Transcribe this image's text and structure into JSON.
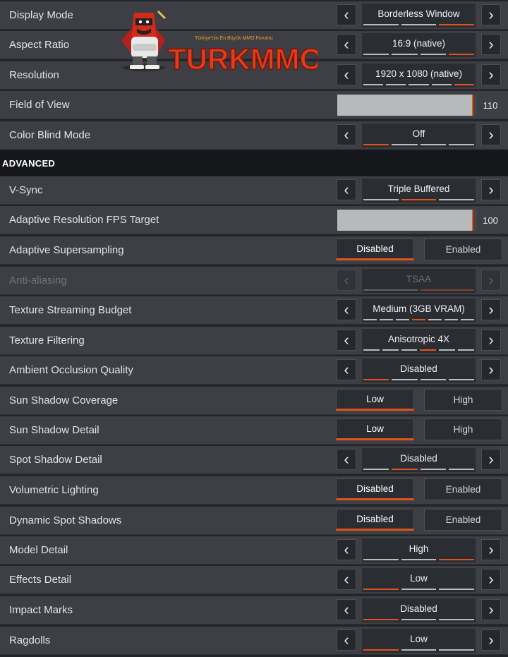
{
  "rows": [
    {
      "label": "Display Mode",
      "type": "selector",
      "value": "Borderless Window",
      "segments": 3,
      "active": 2
    },
    {
      "label": "Aspect Ratio",
      "type": "selector",
      "value": "16:9 (native)",
      "segments": 4,
      "active": 3
    },
    {
      "label": "Resolution",
      "type": "selector",
      "value": "1920 x 1080 (native)",
      "segments": 5,
      "active": 4
    },
    {
      "label": "Field of View",
      "type": "slider",
      "value": "110",
      "fill": 1.0
    },
    {
      "label": "Color Blind Mode",
      "type": "selector",
      "value": "Off",
      "segments": 4,
      "active": 0
    }
  ],
  "section": {
    "title": "ADVANCED"
  },
  "advanced_rows": [
    {
      "label": "V-Sync",
      "type": "selector",
      "value": "Triple Buffered",
      "segments": 3,
      "active": 1
    },
    {
      "label": "Adaptive Resolution FPS Target",
      "type": "slider",
      "value": "100",
      "fill": 1.0
    },
    {
      "label": "Adaptive Supersampling",
      "type": "toggle",
      "options": [
        "Disabled",
        "Enabled"
      ],
      "active": 0
    },
    {
      "label": "Anti-aliasing",
      "type": "selector",
      "value": "TSAA",
      "segments": 2,
      "active": 1,
      "disabled": true
    },
    {
      "label": "Texture Streaming Budget",
      "type": "selector",
      "value": "Medium (3GB VRAM)",
      "segments": 7,
      "active": 3
    },
    {
      "label": "Texture Filtering",
      "type": "selector",
      "value": "Anisotropic 4X",
      "segments": 6,
      "active": 3
    },
    {
      "label": "Ambient Occlusion Quality",
      "type": "selector",
      "value": "Disabled",
      "segments": 4,
      "active": 0
    },
    {
      "label": "Sun Shadow Coverage",
      "type": "toggle",
      "options": [
        "Low",
        "High"
      ],
      "active": 0
    },
    {
      "label": "Sun Shadow Detail",
      "type": "toggle",
      "options": [
        "Low",
        "High"
      ],
      "active": 0
    },
    {
      "label": "Spot Shadow Detail",
      "type": "selector",
      "value": "Disabled",
      "segments": 4,
      "active": 1
    },
    {
      "label": "Volumetric Lighting",
      "type": "toggle",
      "options": [
        "Disabled",
        "Enabled"
      ],
      "active": 0
    },
    {
      "label": "Dynamic Spot Shadows",
      "type": "toggle",
      "options": [
        "Disabled",
        "Enabled"
      ],
      "active": 0
    },
    {
      "label": "Model Detail",
      "type": "selector",
      "value": "High",
      "segments": 3,
      "active": 2
    },
    {
      "label": "Effects Detail",
      "type": "selector",
      "value": "Low",
      "segments": 3,
      "active": 0
    },
    {
      "label": "Impact Marks",
      "type": "selector",
      "value": "Disabled",
      "segments": 3,
      "active": 0
    },
    {
      "label": "Ragdolls",
      "type": "selector",
      "value": "Low",
      "segments": 3,
      "active": 0
    }
  ],
  "watermark": {
    "brand": "TURKMMO",
    "tagline": "Türkiye'nin En Büyük MMO Forumu"
  },
  "colors": {
    "accent": "#e1521e",
    "row": "#3d3f44",
    "section": "#15171b"
  }
}
